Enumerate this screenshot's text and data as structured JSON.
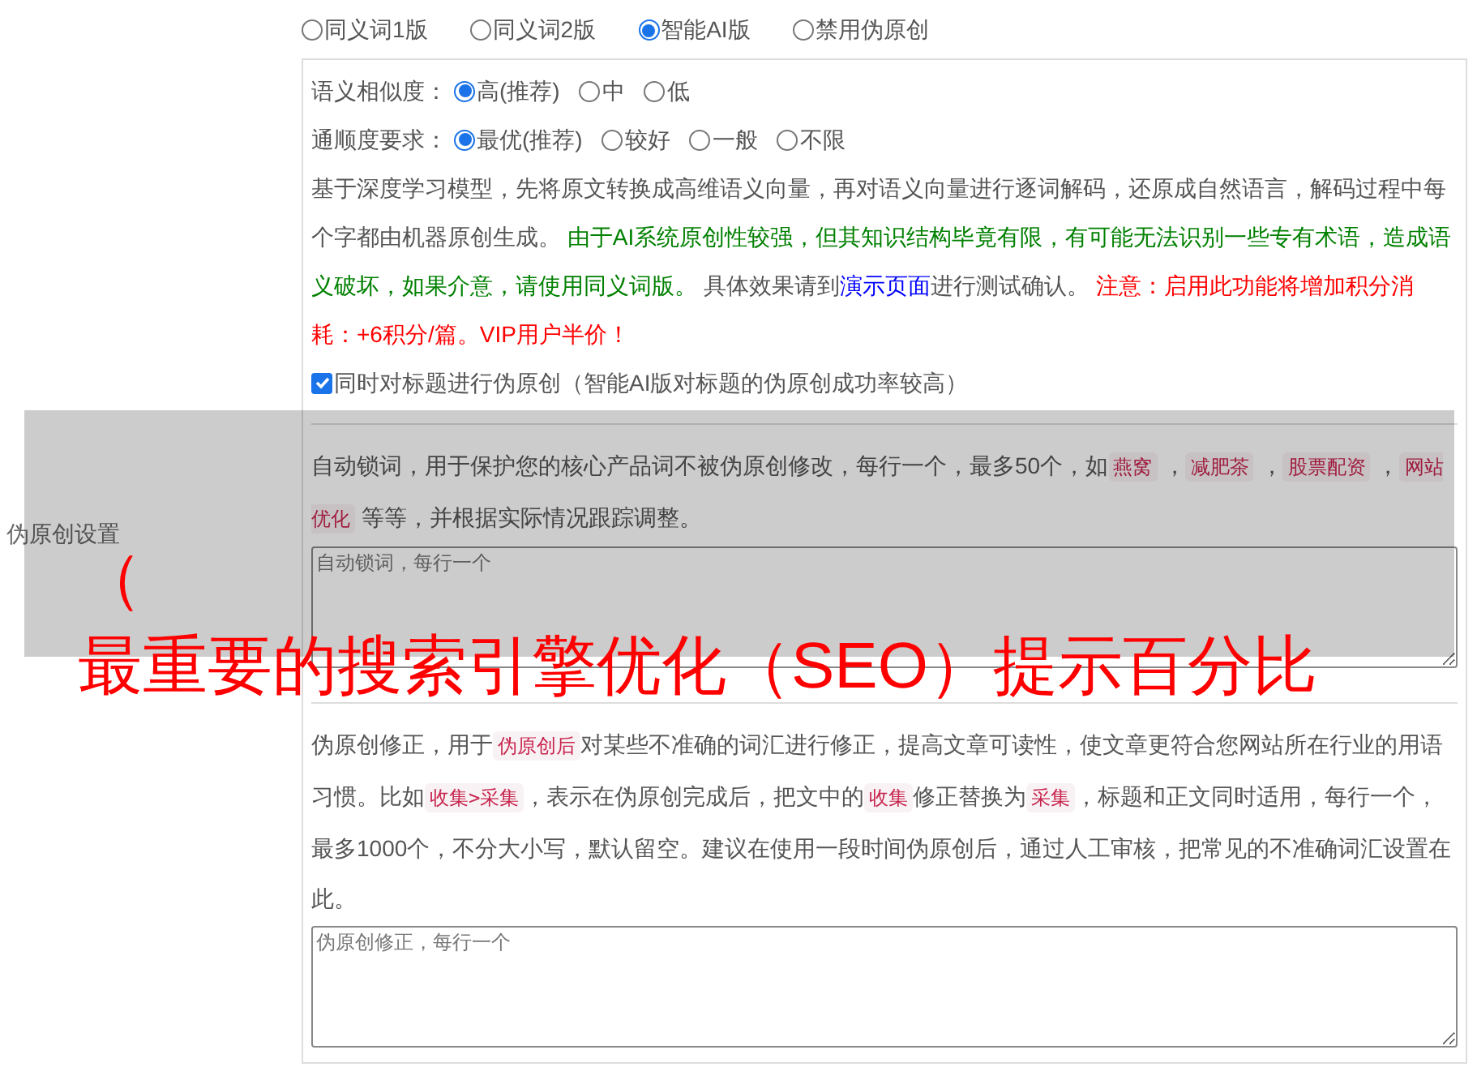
{
  "section_label": "伪原创设置",
  "modes": [
    {
      "label": "同义词1版",
      "selected": false
    },
    {
      "label": "同义词2版",
      "selected": false
    },
    {
      "label": "智能AI版",
      "selected": true
    },
    {
      "label": "禁用伪原创",
      "selected": false
    }
  ],
  "similarity": {
    "label": "语义相似度：",
    "options": [
      {
        "label": "高(推荐)",
        "selected": true
      },
      {
        "label": "中",
        "selected": false
      },
      {
        "label": "低",
        "selected": false
      }
    ]
  },
  "fluency": {
    "label": "通顺度要求：",
    "options": [
      {
        "label": "最优(推荐)",
        "selected": true
      },
      {
        "label": "较好",
        "selected": false
      },
      {
        "label": "一般",
        "selected": false
      },
      {
        "label": "不限",
        "selected": false
      }
    ]
  },
  "description": [
    {
      "kind": "plain",
      "text": "基于深度学习模型，先将原文转换成高维语义向量，再对语义向量进行逐词解码，还原成自然语言，解码过程中每个字都由机器原创生成。 "
    },
    {
      "kind": "note",
      "text": "由于AI系统原创性较强，但其知识结构毕竟有限，有可能无法识别一些专有术语，造成语义破坏，如果介意，请使用同义词版。"
    },
    {
      "kind": "plain",
      "text": " 具体效果请到"
    },
    {
      "kind": "link",
      "text": "演示页面"
    },
    {
      "kind": "plain",
      "text": "进行测试确认。 "
    },
    {
      "kind": "warning",
      "text": "注意：启用此功能将增加积分消耗：+6积分/篇。VIP用户半价！"
    }
  ],
  "title_option": {
    "label": "同时对标题进行伪原创（智能AI版对标题的伪原创成功率较高）",
    "checked": true
  },
  "lock_words": {
    "help": [
      {
        "kind": "plain",
        "text": "自动锁词，用于保护您的核心产品词不被伪原创修改，每行一个，最多50个，如"
      },
      {
        "kind": "tag",
        "text": "燕窝"
      },
      {
        "kind": "plain",
        "text": " ，"
      },
      {
        "kind": "tag",
        "text": "减肥茶"
      },
      {
        "kind": "plain",
        "text": " ，"
      },
      {
        "kind": "tag",
        "text": "股票配资"
      },
      {
        "kind": "plain",
        "text": " ，"
      },
      {
        "kind": "tag",
        "text": "网站优化"
      },
      {
        "kind": "plain",
        "text": " 等等，并根据实际情况跟踪调整。"
      }
    ],
    "placeholder": "自动锁词，每行一个"
  },
  "corrections": {
    "help": [
      {
        "kind": "plain",
        "text": "伪原创修正，用于"
      },
      {
        "kind": "tag",
        "text": "伪原创后"
      },
      {
        "kind": "plain",
        "text": "对某些不准确的词汇进行修正，提高文章可读性，使文章更符合您网站所在行业的用语习惯。比如"
      },
      {
        "kind": "tag",
        "text": "收集>采集"
      },
      {
        "kind": "plain",
        "text": "，表示在伪原创完成后，把文中的"
      },
      {
        "kind": "tag",
        "text": "收集"
      },
      {
        "kind": "plain",
        "text": "修正替换为"
      },
      {
        "kind": "tag",
        "text": "采集"
      },
      {
        "kind": "plain",
        "text": "，标题和正文同时适用，每行一个，最多1000个，不分大小写，默认留空。建议在使用一段时间伪原创后，通过人工审核，把常见的不准确词汇设置在此。"
      }
    ],
    "placeholder": "伪原创修正，每行一个"
  },
  "overlay": {
    "lines": [
      "（",
      "最重要的搜索引擎优化（SEO）提示百分比"
    ]
  }
}
